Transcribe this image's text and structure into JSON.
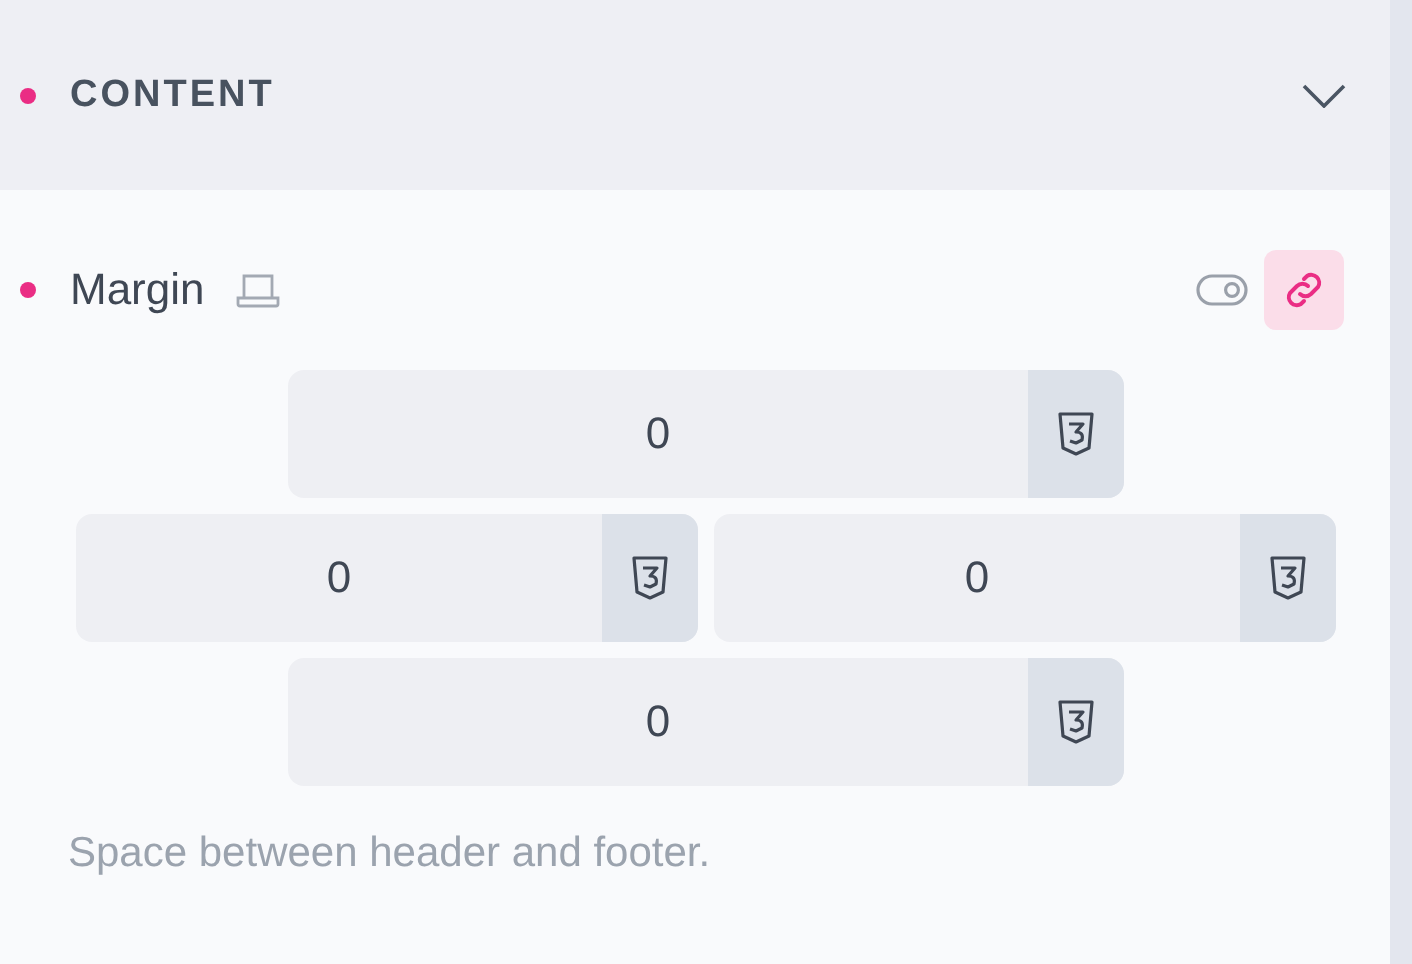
{
  "section": {
    "title": "CONTENT",
    "expanded": true
  },
  "control": {
    "label": "Margin",
    "linked": true,
    "fields": [
      {
        "value": "0"
      },
      {
        "value": "0"
      },
      {
        "value": "0"
      },
      {
        "value": "0"
      }
    ],
    "help": "Space between header and footer."
  }
}
